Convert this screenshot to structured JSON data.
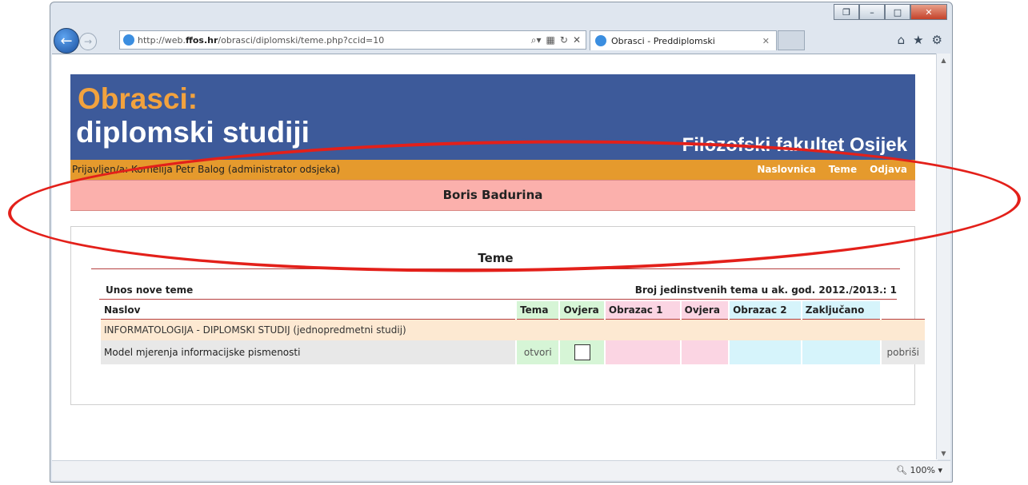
{
  "browser": {
    "address_prefix": "http://web.",
    "address_domain": "ffos.hr",
    "address_path": "/obrasci/diplomski/teme.php?ccid=10",
    "tab_title": "Obrasci - Preddiplomski",
    "zoom": "100%"
  },
  "site": {
    "title_line1": "Obrasci:",
    "title_line2": "diplomski studiji",
    "institution": "Filozofski fakultet Osijek",
    "logged_in": "Prijavljen/a: Kornelija Petr Balog (administrator odsjeka)",
    "nav": [
      "Naslovnica",
      "Teme",
      "Odjava"
    ],
    "student_name": "Boris Badurina"
  },
  "teme": {
    "title": "Teme",
    "new_topic_link": "Unos nove teme",
    "unique_count_label": "Broj jedinstvenih tema u ak. god. 2012./2013.: 1",
    "columns": [
      "Naslov",
      "Tema",
      "Ovjera",
      "Obrazac 1",
      "Ovjera",
      "Obrazac 2",
      "Zaključano"
    ],
    "group": "INFORMATOLOGIJA - DIPLOMSKI STUDIJ (jednopredmetni studij)",
    "rows": [
      {
        "naslov": "Model mjerenja informacijske pismenosti",
        "tema_action": "otvori",
        "delete_action": "pobriši"
      }
    ]
  },
  "colors": {
    "header_blue": "#3d5a9a",
    "orange_bar": "#e59a2d",
    "student_bar": "#fbb0ac",
    "annotation_red": "#e3201a"
  }
}
